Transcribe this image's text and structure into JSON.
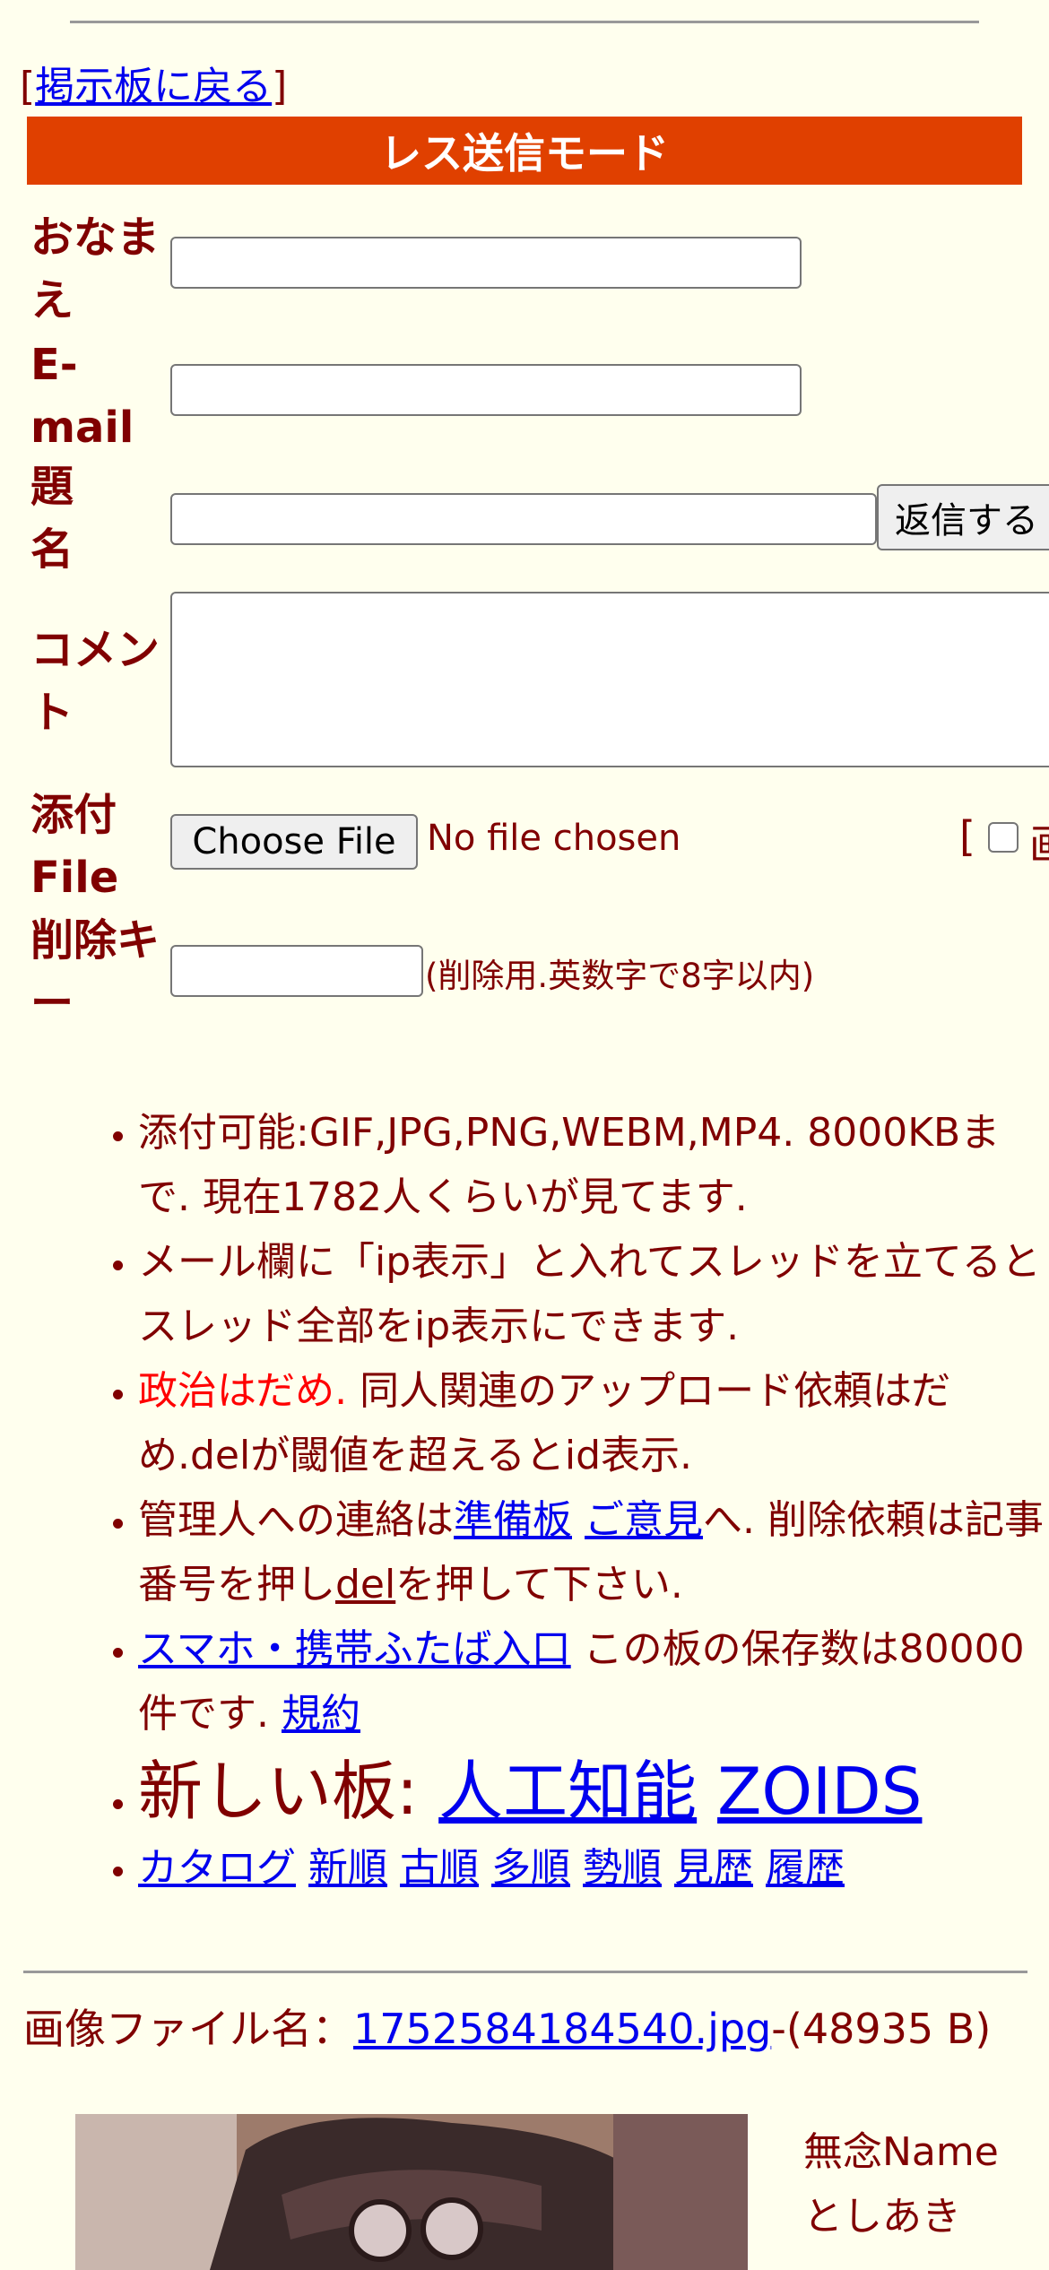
{
  "back_link": {
    "open": "[",
    "label": "掲示板に戻る",
    "close": "]"
  },
  "mode_bar": "レス送信モード",
  "form": {
    "name_label": "おなまえ",
    "email_label": "E-mail",
    "subject_label": "題名",
    "comment_label": "コメント",
    "file_label": "添付File",
    "delkey_label": "削除キー",
    "reply_button": "返信する",
    "choose_file_button": "Choose File",
    "no_file_text": "No file chosen",
    "image_option_open": "[",
    "image_option_label": "画",
    "delkey_note": "(削除用.英数字で8字以内)"
  },
  "notes": {
    "n1": "添付可能:GIF,JPG,PNG,WEBM,MP4. 8000KBまで. 現在1782人くらいが見てます.",
    "n2": "メール欄に「ip表示」と入れてスレッドを立てるとスレッド全部をip表示にできます.",
    "n3_red": "政治はだめ.",
    "n3_rest": " 同人関連のアップロード依頼はだめ.delが閾値を超えるとid表示.",
    "n4_a": "管理人への連絡は",
    "n4_link1": "準備板",
    "n4_link2": "ご意見",
    "n4_b": "へ. 削除依頼は記事番号を押し",
    "n4_del": "del",
    "n4_c": "を押して下さい.",
    "n5_link": "スマホ・携帯ふたば入口",
    "n5_text": " この板の保存数は80000件です. ",
    "n5_rules": "規約",
    "new_board_label": "新しい板: ",
    "new_board_1": "人工知能",
    "new_board_2": "ZOIDS",
    "sort_links": [
      "カタログ",
      "新順",
      "古順",
      "多順",
      "勢順",
      "見歴",
      "履歴"
    ]
  },
  "post": {
    "file_label": "画像ファイル名：",
    "file_name": "1752584184540.jpg",
    "file_size": "-(48935 B)",
    "name_line1": "無念Name",
    "name_line2": "としあき"
  }
}
